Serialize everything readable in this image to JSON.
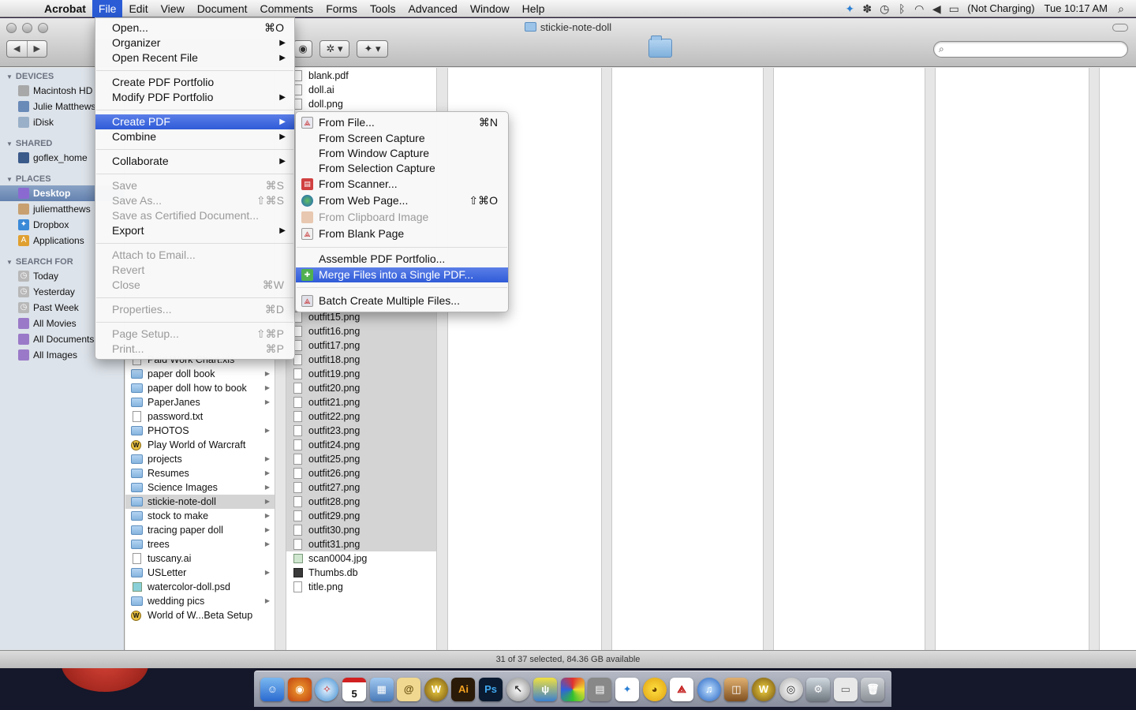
{
  "menubar": {
    "app": "Acrobat",
    "items": [
      "File",
      "Edit",
      "View",
      "Document",
      "Comments",
      "Forms",
      "Tools",
      "Advanced",
      "Window",
      "Help"
    ],
    "battery": "(Not Charging)",
    "clock": "Tue 10:17 AM"
  },
  "window": {
    "title": "stickie-note-doll"
  },
  "sidebar": {
    "devices_header": "DEVICES",
    "devices": [
      "Macintosh HD",
      "Julie Matthews",
      "iDisk"
    ],
    "shared_header": "SHARED",
    "shared": [
      "goflex_home"
    ],
    "places_header": "PLACES",
    "places": [
      "Desktop",
      "juliematthews",
      "Dropbox",
      "Applications"
    ],
    "search_header": "SEARCH FOR",
    "search": [
      "Today",
      "Yesterday",
      "Past Week",
      "All Movies",
      "All Documents",
      "All Images"
    ]
  },
  "col1": {
    "partial": "Paid Work Chart.xls",
    "items": [
      "paper doll book",
      "paper doll how to book",
      "PaperJanes",
      "password.txt",
      "PHOTOS",
      "Play World of Warcraft",
      "projects",
      "Resumes",
      "Science Images",
      "stickie-note-doll",
      "stock to make",
      "tracing paper doll",
      "trees",
      "tuscany.ai",
      "USLetter",
      "watercolor-doll.psd",
      "wedding pics",
      "World of W...Beta Setup"
    ]
  },
  "col2": {
    "top": [
      "blank.pdf",
      "doll.ai",
      "doll.png"
    ],
    "outfits": [
      "outfit15.png",
      "outfit16.png",
      "outfit17.png",
      "outfit18.png",
      "outfit19.png",
      "outfit20.png",
      "outfit21.png",
      "outfit22.png",
      "outfit23.png",
      "outfit24.png",
      "outfit25.png",
      "outfit26.png",
      "outfit27.png",
      "outfit28.png",
      "outfit29.png",
      "outfit30.png",
      "outfit31.png"
    ],
    "bottom": [
      "scan0004.jpg",
      "Thumbs.db",
      "title.png"
    ]
  },
  "status": "31 of 37 selected, 84.36 GB available",
  "file_menu": {
    "open": "Open...",
    "open_sc": "⌘O",
    "organizer": "Organizer",
    "open_recent": "Open Recent File",
    "create_portfolio": "Create PDF Portfolio",
    "modify_portfolio": "Modify PDF Portfolio",
    "create_pdf": "Create PDF",
    "combine": "Combine",
    "collaborate": "Collaborate",
    "save": "Save",
    "save_sc": "⌘S",
    "save_as": "Save As...",
    "save_as_sc": "⇧⌘S",
    "save_certified": "Save as Certified Document...",
    "export": "Export",
    "attach_email": "Attach to Email...",
    "revert": "Revert",
    "close": "Close",
    "close_sc": "⌘W",
    "properties": "Properties...",
    "properties_sc": "⌘D",
    "page_setup": "Page Setup...",
    "page_setup_sc": "⇧⌘P",
    "print": "Print...",
    "print_sc": "⌘P"
  },
  "create_pdf_menu": {
    "from_file": "From File...",
    "from_file_sc": "⌘N",
    "from_screen": "From Screen Capture",
    "from_window": "From Window Capture",
    "from_selection": "From Selection Capture",
    "from_scanner": "From Scanner...",
    "from_web": "From Web Page...",
    "from_web_sc": "⇧⌘O",
    "from_clipboard": "From Clipboard Image",
    "from_blank": "From Blank Page",
    "assemble": "Assemble PDF Portfolio...",
    "merge": "Merge Files into a Single PDF...",
    "batch": "Batch Create Multiple Files..."
  },
  "colors": {
    "highlight": "#2f5bd8",
    "menubar_active": "#2b5cd6",
    "sidebar_selected": "#6482b0"
  },
  "dock": {
    "icons": [
      "finder-icon",
      "firefox-icon",
      "safari-icon",
      "ical-icon",
      "preview-icon",
      "stickies-icon",
      "warcraft-icon",
      "illustrator-icon",
      "photoshop-icon",
      "cursor-icon",
      "instinct-icon",
      "colorsync-icon",
      "calculator-icon",
      "dropbox-icon",
      "cyberduck-icon",
      "acrobat-icon",
      "itunes-icon",
      "imagecapture-icon",
      "warcraft2-icon",
      "airport-icon",
      "preferences-icon",
      "document-icon",
      "trash-icon"
    ],
    "ical_day": "5",
    "ai_label": "Ai",
    "ps_label": "Ps"
  }
}
